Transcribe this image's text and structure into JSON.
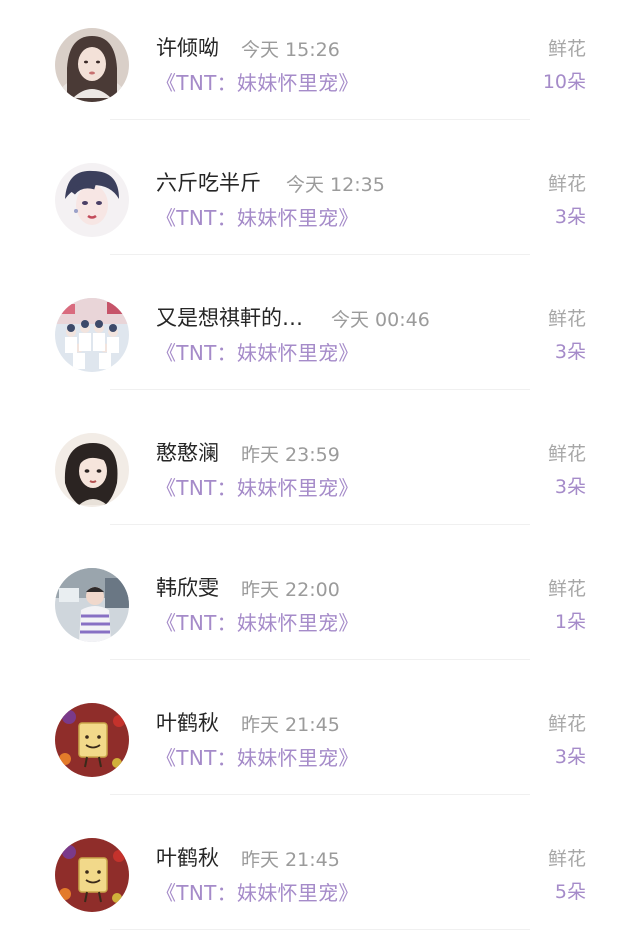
{
  "rows": [
    {
      "name": "许倾呦",
      "time": "今天 15:26",
      "book": "《TNT：妹妹怀里宠》",
      "gift_label": "鲜花",
      "gift_count": "10朵",
      "avatar": "girl-portrait-avatar"
    },
    {
      "name": "六斤吃半斤",
      "time": "今天 12:35",
      "book": "《TNT：妹妹怀里宠》",
      "gift_label": "鲜花",
      "gift_count": "3朵",
      "avatar": "anime-boy-avatar"
    },
    {
      "name": "又是想祺軒的…",
      "time": "今天 00:46",
      "book": "《TNT：妹妹怀里宠》",
      "gift_label": "鲜花",
      "gift_count": "3朵",
      "avatar": "group-photo-avatar"
    },
    {
      "name": "憨憨澜",
      "time": "昨天 23:59",
      "book": "《TNT：妹妹怀里宠》",
      "gift_label": "鲜花",
      "gift_count": "3朵",
      "avatar": "illustrated-girl-avatar"
    },
    {
      "name": "韩欣雯",
      "time": "昨天 22:00",
      "book": "《TNT：妹妹怀里宠》",
      "gift_label": "鲜花",
      "gift_count": "1朵",
      "avatar": "boy-photo-avatar"
    },
    {
      "name": "叶鹤秋",
      "time": "昨天 21:45",
      "book": "《TNT：妹妹怀里宠》",
      "gift_label": "鲜花",
      "gift_count": "3朵",
      "avatar": "cookie-cartoon-avatar"
    },
    {
      "name": "叶鹤秋",
      "time": "昨天 21:45",
      "book": "《TNT：妹妹怀里宠》",
      "gift_label": "鲜花",
      "gift_count": "5朵",
      "avatar": "cookie-cartoon-avatar"
    }
  ]
}
